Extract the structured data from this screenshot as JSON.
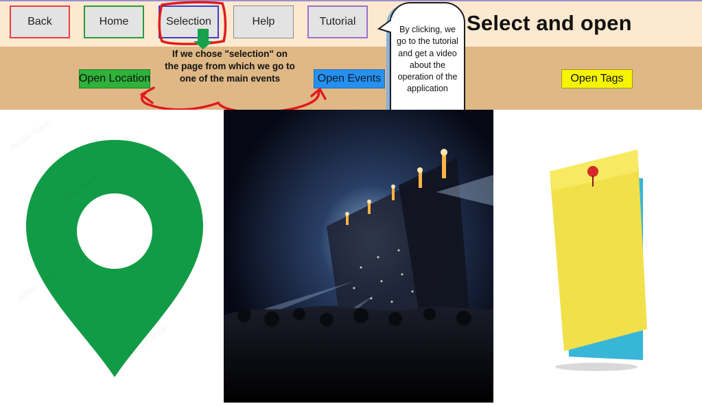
{
  "nav": {
    "back_label": "Back",
    "home_label": "Home",
    "selection_label": "Selection",
    "help_label": "Help",
    "tutorial_label": "Tutorial"
  },
  "page_title": "Select and open",
  "actions": {
    "open_location_label": "Open Location",
    "open_events_label": "Open Events",
    "open_tags_label": "Open Tags"
  },
  "annotation": "If we chose \"selection\" on the page from which we go to one of the main events",
  "tutorial_bubble": "By clicking, we go to the tutorial and get a video about the operation of the application",
  "images": {
    "location": "location-pin-icon",
    "events": "concert-crowd-photo",
    "tags": "sticky-note-icon"
  },
  "watermark": "Adobe Stock",
  "colors": {
    "top_band": "#fde9cf",
    "mid_band": "#dfb886",
    "location_green": "#129b46",
    "events_blue": "#2690ee",
    "tags_yellow": "#f7f400",
    "annotation_red": "#e21b1b",
    "annotation_arrow_green": "#16a14a"
  }
}
